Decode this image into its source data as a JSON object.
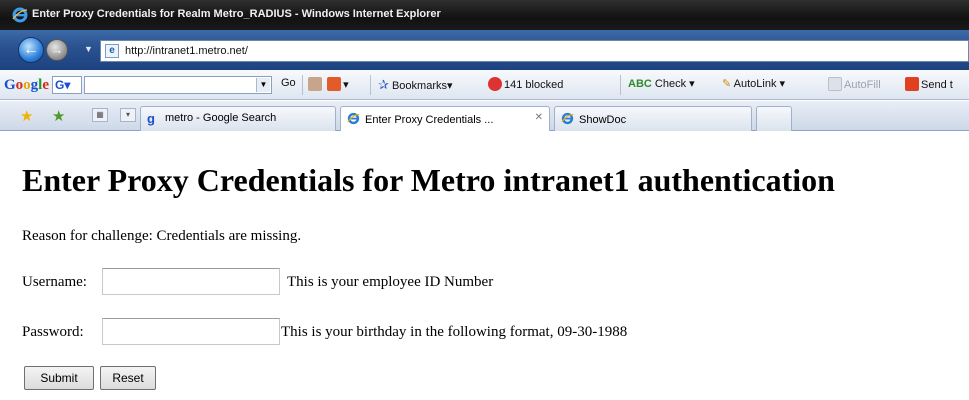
{
  "window": {
    "title": "Enter Proxy Credentials for Realm Metro_RADIUS - Windows Internet Explorer",
    "app_icon": "internet-explorer-icon"
  },
  "address_bar": {
    "url": "http://intranet1.metro.net/"
  },
  "google_toolbar": {
    "logo_letters": [
      "G",
      "o",
      "o",
      "g",
      "l",
      "e"
    ],
    "g_button": "G",
    "go_label": "Go",
    "bookmarks_label": "Bookmarks",
    "blocked_label": "141 blocked",
    "check_label": "Check",
    "autolink_label": "AutoLink",
    "autofill_label": "AutoFill",
    "send_label": "Send t"
  },
  "tabs": [
    {
      "label": "metro - Google Search",
      "icon": "google-icon",
      "active": false
    },
    {
      "label": "Enter Proxy Credentials ...",
      "icon": "internet-explorer-icon",
      "active": true
    },
    {
      "label": "ShowDoc",
      "icon": "internet-explorer-icon",
      "active": false
    },
    {
      "label": "",
      "icon": "",
      "active": false
    }
  ],
  "page": {
    "heading": "Enter Proxy Credentials for Metro intranet1 authentication",
    "reason": "Reason for challenge: Credentials are missing.",
    "username_label": "Username:",
    "username_value": "",
    "username_hint": "This is your employee ID Number",
    "password_label": "Password:",
    "password_value": "",
    "password_hint": "This is your birthday in the following format, 09-30-1988",
    "submit_label": "Submit",
    "reset_label": "Reset"
  }
}
